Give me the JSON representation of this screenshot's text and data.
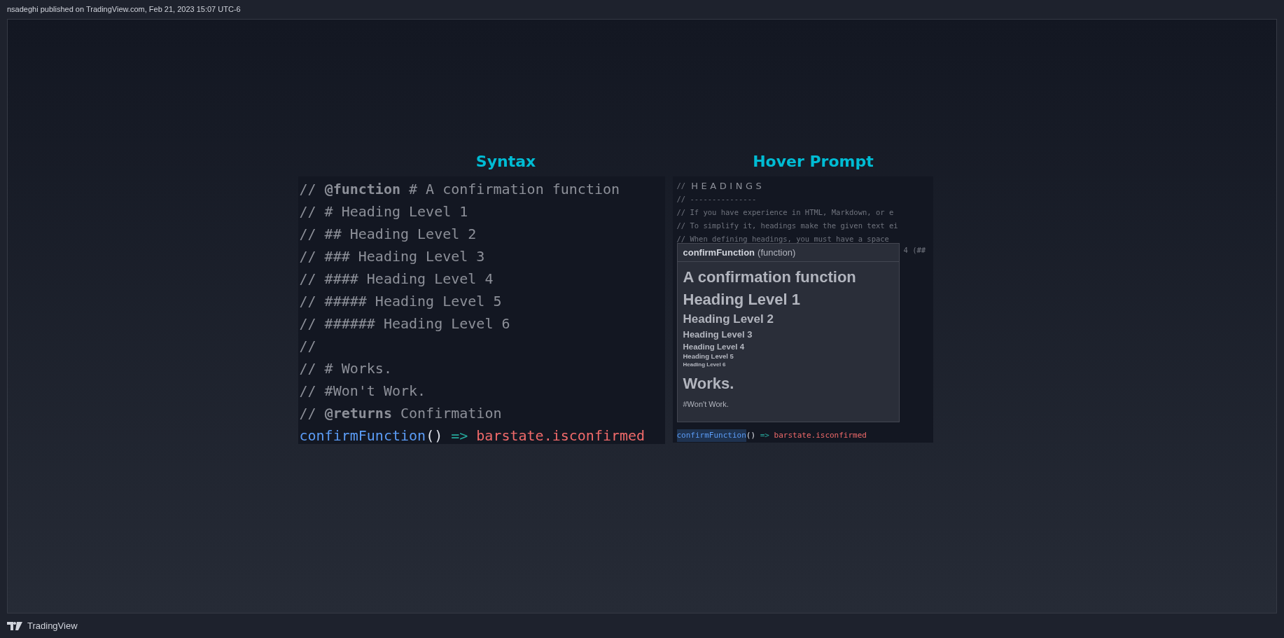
{
  "header": {
    "attribution": "nsadeghi published on TradingView.com, Feb 21, 2023 15:07 UTC-6"
  },
  "syntax_panel": {
    "title": "Syntax",
    "lines": [
      {
        "kind": "comment",
        "text": "// **@function** # A confirmation function"
      },
      {
        "kind": "comment",
        "text": "// # Heading Level 1"
      },
      {
        "kind": "comment",
        "text": "// ## Heading Level 2"
      },
      {
        "kind": "comment",
        "text": "// ### Heading Level 3"
      },
      {
        "kind": "comment",
        "text": "// #### Heading Level 4"
      },
      {
        "kind": "comment",
        "text": "// ##### Heading Level 5"
      },
      {
        "kind": "comment",
        "text": "// ###### Heading Level 6"
      },
      {
        "kind": "comment",
        "text": "//"
      },
      {
        "kind": "comment",
        "text": "// # Works."
      },
      {
        "kind": "comment",
        "text": "// #Won't Work."
      },
      {
        "kind": "comment",
        "text": "// **@returns** Confirmation"
      },
      {
        "kind": "code",
        "tokens": [
          {
            "kind": "function",
            "text": "confirmFunction"
          },
          {
            "kind": "punct",
            "text": "()"
          },
          {
            "kind": "operator",
            "text": "=>"
          },
          {
            "kind": "variable",
            "text": "barstate.isconfirmed"
          }
        ]
      }
    ]
  },
  "hover_panel": {
    "title": "Hover Prompt",
    "editor_lines": [
      {
        "kind": "title",
        "prefix": "//",
        "text": "HEADINGS"
      },
      {
        "kind": "comment",
        "text": "// ---------------"
      },
      {
        "kind": "comment",
        "text": "// If you have experience in HTML, Markdown, or e"
      },
      {
        "kind": "comment",
        "text": "// To simplify it, headings make the given text ei"
      },
      {
        "kind": "comment",
        "text": "// When defining headings, you must have a space"
      },
      {
        "kind": "fragment",
        "text": "4 (##"
      }
    ],
    "code_line": {
      "tokens": [
        {
          "kind": "function",
          "text": "confirmFunction",
          "highlighted": true
        },
        {
          "kind": "punct",
          "text": "()",
          "highlighted": false
        },
        {
          "kind": "operator",
          "text": "=>",
          "highlighted": false
        },
        {
          "kind": "variable",
          "text": "barstate.isconfirmed",
          "highlighted": false
        }
      ]
    },
    "popup": {
      "name": "confirmFunction",
      "type_label": "(function)",
      "blocks": [
        {
          "kind": "h1",
          "text": "A confirmation function"
        },
        {
          "kind": "h1",
          "text": "Heading Level 1"
        },
        {
          "kind": "h2",
          "text": "Heading Level 2"
        },
        {
          "kind": "h3",
          "text": "Heading Level 3"
        },
        {
          "kind": "h4",
          "text": "Heading Level 4"
        },
        {
          "kind": "h5",
          "text": "Heading Level 5"
        },
        {
          "kind": "h6",
          "text": "Heading Level 6"
        },
        {
          "kind": "h1",
          "text": "Works."
        },
        {
          "kind": "p",
          "text": "#Won't Work."
        }
      ]
    }
  },
  "footer": {
    "brand": "TradingView"
  }
}
